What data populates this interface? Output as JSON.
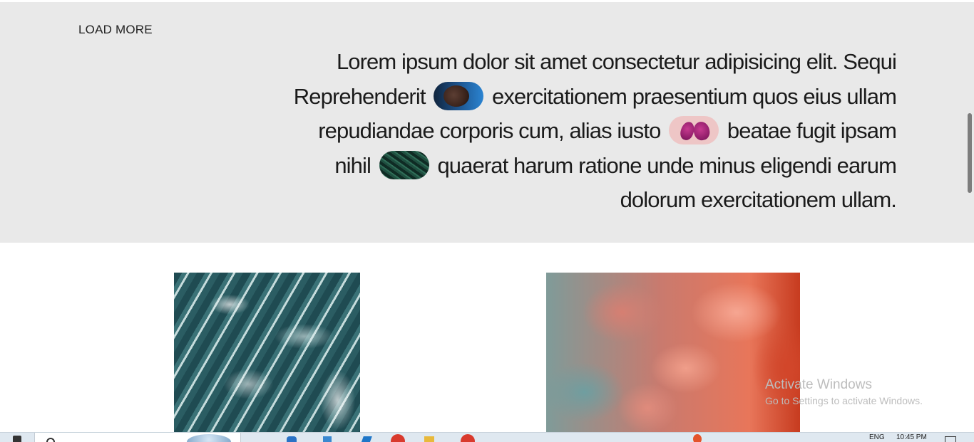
{
  "hero": {
    "load_more_label": "LOAD MORE",
    "text_segments": {
      "s1": "Lorem ipsum dolor sit amet consectetur adipisicing elit. Sequi Reprehenderit",
      "s2": "exercitationem praesentium quos eius ullam repudiandae corporis cum, alias iusto",
      "s3": "beatae fugit ipsam nihil",
      "s4": "quaerat harum ratione unde minus eligendi earum dolorum exercitationem ullam."
    }
  },
  "watermark": {
    "title": "Activate Windows",
    "subtitle": "Go to Settings to activate Windows."
  },
  "taskbar": {
    "language": "ENG",
    "time": "10:45 PM"
  },
  "colors": {
    "hero_background": "#e9e9e9",
    "body_text": "#1b1b1b",
    "scroll_thumb": "#7d7d7d"
  },
  "icons": {
    "pill_1": "portrait-image",
    "pill_2": "lungs-image",
    "pill_3": "leaves-image",
    "tile_1": "ocean-waves-image",
    "tile_2": "pink-clouds-image"
  }
}
